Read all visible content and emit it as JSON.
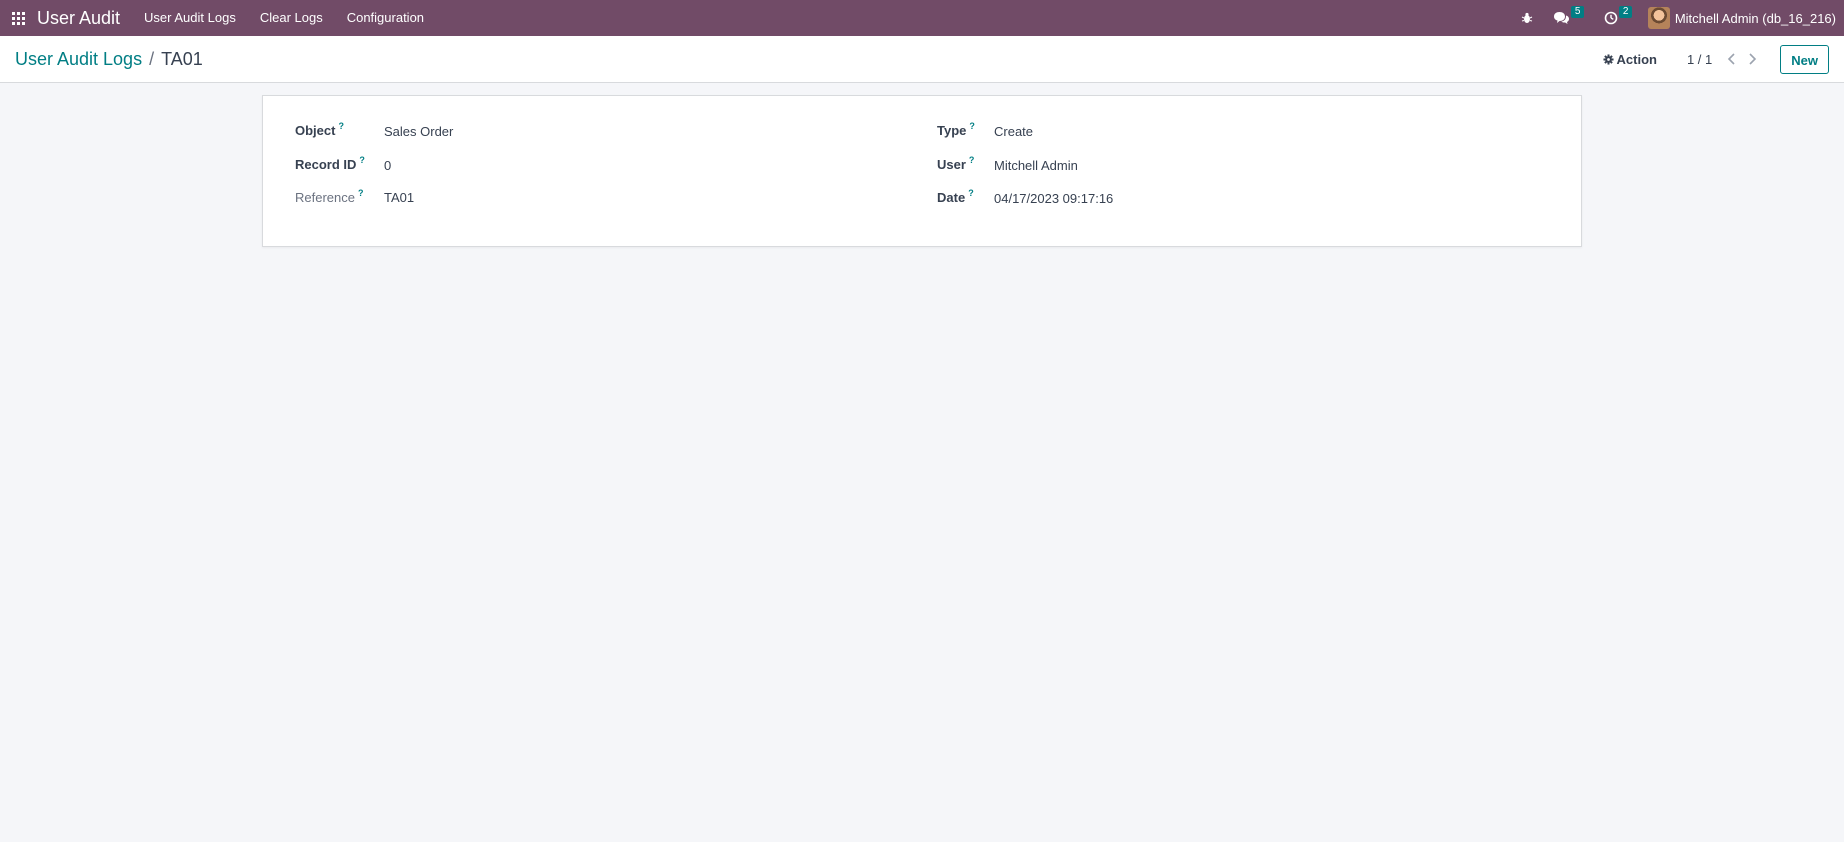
{
  "navbar": {
    "app_title": "User Audit",
    "menu": [
      {
        "label": "User Audit Logs"
      },
      {
        "label": "Clear Logs"
      },
      {
        "label": "Configuration"
      }
    ],
    "messages_count": "5",
    "activities_count": "2",
    "user_label": "Mitchell Admin (db_16_216)",
    "colors": {
      "navbar_bg": "#714b67",
      "badge_bg": "#017e84"
    }
  },
  "control_panel": {
    "breadcrumb_parent": "User Audit Logs",
    "breadcrumb_separator": "/",
    "breadcrumb_current": "TA01",
    "action_label": "Action",
    "pager": "1 / 1",
    "new_label": "New"
  },
  "form": {
    "left": [
      {
        "label": "Object",
        "value": "Sales Order"
      },
      {
        "label": "Record ID",
        "value": "0"
      },
      {
        "label": "Reference",
        "value": "TA01"
      }
    ],
    "right": [
      {
        "label": "Type",
        "value": "Create"
      },
      {
        "label": "User",
        "value": "Mitchell Admin"
      },
      {
        "label": "Date",
        "value": "04/17/2023 09:17:16"
      }
    ],
    "help_marker": "?"
  },
  "icons": [
    "apps-grid-icon",
    "bug-icon",
    "chat-icon",
    "clock-icon",
    "gear-icon",
    "chevron-left-icon",
    "chevron-right-icon"
  ]
}
